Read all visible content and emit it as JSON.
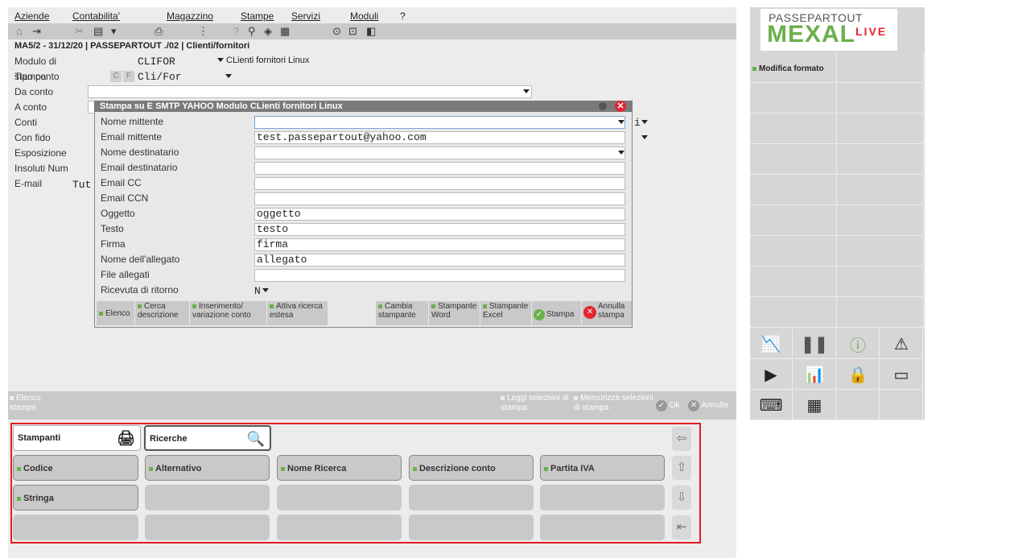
{
  "menu": [
    "Aziende",
    "Contabilita'",
    "Magazzino",
    "Stampe",
    "Servizi",
    "Moduli",
    "?"
  ],
  "breadcrumb": "MA5/2 - 31/12/20 | PASSEPARTOUT ./02 | Clienti/fornitori",
  "form": {
    "modulo_label": "Modulo di stampa",
    "modulo_value": "CLIFOR",
    "modulo_desc": "CLienti fornitori Linux",
    "tipo_label": "Tipo conto",
    "tipo_c": "C",
    "tipo_f": "F",
    "tipo_value": "Cli/For",
    "da_label": "Da conto",
    "a_label": "A conto",
    "conti_label": "Conti",
    "conti_value": "i",
    "confido_label": "Con fido",
    "esposizione_label": "Esposizione",
    "insoluti_label": "Insoluti Num",
    "email_label": "E-mail",
    "email_value": "Tut"
  },
  "dialog": {
    "title": "Stampa su E SMTP YAHOO Modulo CLienti fornitori Linux",
    "fields": [
      {
        "label": "Nome mittente",
        "value": ""
      },
      {
        "label": "Email mittente",
        "value": "test.passepartout@yahoo.com"
      },
      {
        "label": "Nome destinatario",
        "value": ""
      },
      {
        "label": "Email destinatario",
        "value": ""
      },
      {
        "label": "Email CC",
        "value": ""
      },
      {
        "label": "Email CCN",
        "value": ""
      },
      {
        "label": "Oggetto",
        "value": "oggetto"
      },
      {
        "label": "Testo",
        "value": "testo"
      },
      {
        "label": "Firma",
        "value": "firma"
      },
      {
        "label": "Nome dell'allegato",
        "value": "allegato"
      },
      {
        "label": "File allegati",
        "value": ""
      }
    ],
    "ricevuta_label": "Ricevuta di ritorno",
    "ricevuta_value": "N",
    "buttons": {
      "elenco": "Elenco",
      "cerca": "Cerca descrizione",
      "inserimento": "Inserimento/ variazione conto",
      "attiva": "Attiva ricerca estesa",
      "cambia": "Cambia stampante",
      "word": "Stampante Word",
      "excel": "Stampante Excel",
      "stampa": "Stampa",
      "annulla": "Annulla stampa"
    }
  },
  "bottombar": {
    "elenco_stampe": "Elenco stampe",
    "leggi": "Leggi selezioni di stampa",
    "memorizza": "Memorizza selezioni di stampa",
    "ok": "Ok",
    "annulla": "Annulla"
  },
  "right": {
    "logo_top": "PASSEPARTOUT",
    "logo_main": "MEXAL",
    "logo_live": "LIVE",
    "modifica_formato": "Modifica formato"
  },
  "keypad": {
    "tab_stampanti": "Stampanti",
    "tab_ricerche": "Ricerche",
    "buttons": [
      "Codice",
      "Alternativo",
      "Nome Ricerca",
      "Descrizione conto",
      "Partita IVA",
      "Stringa"
    ]
  },
  "colors": {
    "accent_green": "#6ab04c",
    "red": "#e3262f",
    "bar_gray": "#c9c9c9"
  }
}
